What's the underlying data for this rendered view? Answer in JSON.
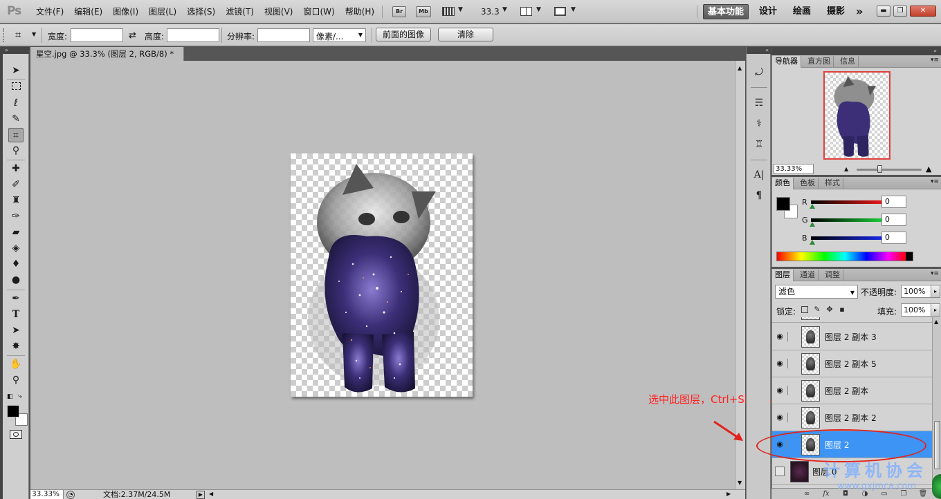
{
  "app": {
    "logo": "Ps",
    "menu": [
      "文件(F)",
      "编辑(E)",
      "图像(I)",
      "图层(L)",
      "选择(S)",
      "滤镜(T)",
      "视图(V)",
      "窗口(W)",
      "帮助(H)"
    ],
    "bridge_btn": "Br",
    "minibridge_btn": "Mb",
    "zoom": "33.3",
    "workspaces": [
      "基本功能",
      "设计",
      "绘画",
      "摄影"
    ],
    "more_workspaces": "»",
    "window_buttons": {
      "minimize": "▬",
      "restore": "❐",
      "close": "✕"
    }
  },
  "options": {
    "width_label": "宽度:",
    "width_value": "",
    "swap_icon": "⇄",
    "height_label": "高度:",
    "height_value": "",
    "resolution_label": "分辨率:",
    "resolution_value": "",
    "unit": "像素/...",
    "front_image_button": "前面的图像",
    "clear_button": "清除"
  },
  "document": {
    "tab_title": "星空.jpg @ 33.3% (图层 2, RGB/8) *",
    "tab_close": "✕",
    "zoom_status": "33.33%",
    "doc_size": "文档:2.37M/24.5M"
  },
  "annotation": {
    "text": "选中此图层，Ctrl+Shift+Alt+E得到盖印图层"
  },
  "navigator": {
    "tabs": [
      "导航器",
      "直方图",
      "信息"
    ],
    "zoom": "33.33%"
  },
  "color": {
    "tabs": [
      "颜色",
      "色板",
      "样式"
    ],
    "channels": [
      {
        "label": "R",
        "value": "0",
        "color": "#c81010"
      },
      {
        "label": "G",
        "value": "0",
        "color": "#10a828"
      },
      {
        "label": "B",
        "value": "0",
        "color": "#1018c8"
      }
    ]
  },
  "layers": {
    "tabs": [
      "图层",
      "通道",
      "调整"
    ],
    "blend_mode": "滤色",
    "opacity_label": "不透明度:",
    "opacity": "100%",
    "lock_label": "锁定:",
    "fill_label": "填充:",
    "fill": "100%",
    "items": [
      {
        "name": "图层 2 副本 3",
        "visible": true,
        "selected": false
      },
      {
        "name": "图层 2 副本 5",
        "visible": true,
        "selected": false
      },
      {
        "name": "图层 2 副本",
        "visible": true,
        "selected": false
      },
      {
        "name": "图层 2 副本 2",
        "visible": true,
        "selected": false
      },
      {
        "name": "图层 2",
        "visible": true,
        "selected": true
      },
      {
        "name": "图层 0",
        "visible": false,
        "selected": false
      }
    ]
  },
  "watermark": {
    "text": "计算机协会",
    "url": "www.gxjmca.com"
  },
  "colors": {
    "selected_layer": "#3d94f5",
    "annotation": "#ff2020"
  }
}
